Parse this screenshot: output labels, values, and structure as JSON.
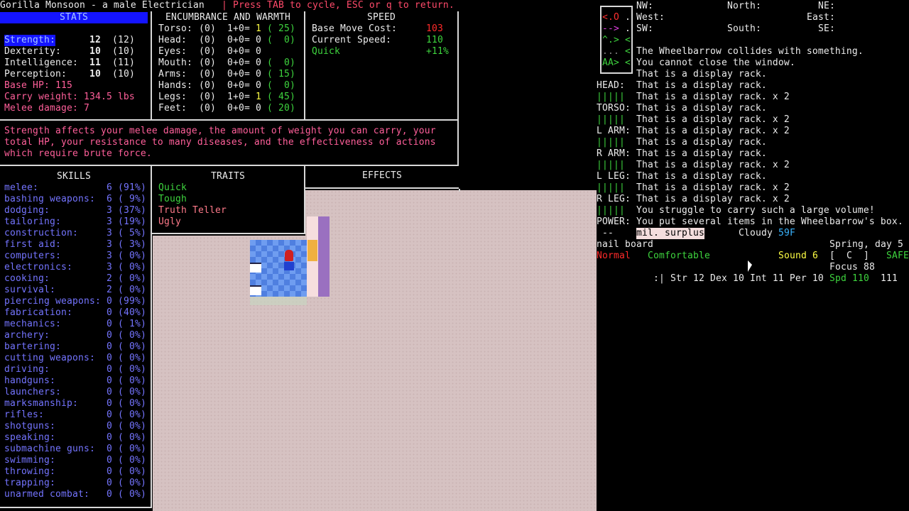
{
  "header": {
    "title": "Gorilla Monsoon - a male Electrician",
    "hint": "| Press TAB to cycle, ESC or q to return."
  },
  "stats": {
    "title": "STATS",
    "rows": [
      {
        "label": "Strength:",
        "value": "12",
        "base": "(12)",
        "selected": true
      },
      {
        "label": "Dexterity:",
        "value": "10",
        "base": "(10)"
      },
      {
        "label": "Intelligence:",
        "value": "11",
        "base": "(11)"
      },
      {
        "label": "Perception:",
        "value": "10",
        "base": "(10)"
      }
    ],
    "base_hp": "Base HP: 115",
    "carry_weight": "Carry weight: 134.5 lbs",
    "melee_damage": "Melee damage: 7"
  },
  "encumbrance": {
    "title": "ENCUMBRANCE AND WARMTH",
    "rows": [
      {
        "part": "Torso:",
        "layers": "(0)",
        "formula": "1+0=",
        "total": "1",
        "warmth": "( 25)",
        "highlight": true
      },
      {
        "part": "Head:",
        "layers": "(0)",
        "formula": "0+0=",
        "total": "0",
        "warmth": "(  0)"
      },
      {
        "part": "Eyes:",
        "layers": "(0)",
        "formula": "0+0=",
        "total": "0",
        "warmth": ""
      },
      {
        "part": "Mouth:",
        "layers": "(0)",
        "formula": "0+0=",
        "total": "0",
        "warmth": "(  0)"
      },
      {
        "part": "Arms:",
        "layers": "(0)",
        "formula": "0+0=",
        "total": "0",
        "warmth": "( 15)"
      },
      {
        "part": "Hands:",
        "layers": "(0)",
        "formula": "0+0=",
        "total": "0",
        "warmth": "(  0)"
      },
      {
        "part": "Legs:",
        "layers": "(0)",
        "formula": "1+0=",
        "total": "1",
        "warmth": "( 45)",
        "highlight": true
      },
      {
        "part": "Feet:",
        "layers": "(0)",
        "formula": "0+0=",
        "total": "0",
        "warmth": "( 20)"
      }
    ]
  },
  "speed": {
    "title": "SPEED",
    "base_move_cost_label": "Base Move Cost:",
    "base_move_cost": "103",
    "current_speed_label": "Current Speed:",
    "current_speed": "110",
    "modifier_label": "Quick",
    "modifier": "+11%"
  },
  "description": "Strength affects your melee damage, the amount of weight you can carry, your\ntotal HP, your resistance to many diseases, and the effectiveness of actions\nwhich require brute force.",
  "skills": {
    "title": "SKILLS",
    "rows": [
      [
        "melee:",
        "6 (91%)"
      ],
      [
        "bashing weapons:",
        "6 ( 9%)"
      ],
      [
        "dodging:",
        "3 (37%)"
      ],
      [
        "tailoring:",
        "3 (19%)"
      ],
      [
        "construction:",
        "3 ( 5%)"
      ],
      [
        "first aid:",
        "3 ( 3%)"
      ],
      [
        "computers:",
        "3 ( 0%)"
      ],
      [
        "electronics:",
        "3 ( 0%)"
      ],
      [
        "cooking:",
        "2 ( 0%)"
      ],
      [
        "survival:",
        "2 ( 0%)"
      ],
      [
        "piercing weapons:",
        "0 (99%)"
      ],
      [
        "fabrication:",
        "0 (40%)"
      ],
      [
        "mechanics:",
        "0 ( 1%)"
      ],
      [
        "archery:",
        "0 ( 0%)"
      ],
      [
        "bartering:",
        "0 ( 0%)"
      ],
      [
        "cutting weapons:",
        "0 ( 0%)"
      ],
      [
        "driving:",
        "0 ( 0%)"
      ],
      [
        "handguns:",
        "0 ( 0%)"
      ],
      [
        "launchers:",
        "0 ( 0%)"
      ],
      [
        "marksmanship:",
        "0 ( 0%)"
      ],
      [
        "rifles:",
        "0 ( 0%)"
      ],
      [
        "shotguns:",
        "0 ( 0%)"
      ],
      [
        "speaking:",
        "0 ( 0%)"
      ],
      [
        "submachine guns:",
        "0 ( 0%)"
      ],
      [
        "swimming:",
        "0 ( 0%)"
      ],
      [
        "throwing:",
        "0 ( 0%)"
      ],
      [
        "trapping:",
        "0 ( 0%)"
      ],
      [
        "unarmed combat:",
        "0 ( 0%)"
      ]
    ]
  },
  "traits": {
    "title": "TRAITS",
    "rows": [
      {
        "name": "Quick",
        "color": "#3ed43e"
      },
      {
        "name": "Tough",
        "color": "#3ed43e"
      },
      {
        "name": "Truth Teller",
        "color": "#ff7a8a"
      },
      {
        "name": "Ugly",
        "color": "#ff7a8a"
      }
    ]
  },
  "effects": {
    "title": "EFFECTS"
  },
  "directions": {
    "nw": "NW:",
    "north": "North:",
    "ne": "NE:",
    "west": "West:",
    "east": "East:",
    "sw": "SW:",
    "south": "South:",
    "se": "SE:"
  },
  "minimap": {
    "rows": [
      "<.O",
      "-->",
      "^.>",
      "...",
      "AA>"
    ],
    "side": [
      ".",
      ".",
      "<",
      "<",
      "<"
    ]
  },
  "body_status": [
    {
      "label": "HEAD:"
    },
    {
      "label": "|||||"
    },
    {
      "label": "TORSO:"
    },
    {
      "label": "|||||"
    },
    {
      "label": "L ARM:"
    },
    {
      "label": "|||||"
    },
    {
      "label": "R ARM:"
    },
    {
      "label": "|||||"
    },
    {
      "label": "L LEG:"
    },
    {
      "label": "|||||"
    },
    {
      "label": "R LEG:"
    },
    {
      "label": "|||||"
    },
    {
      "label": "POWER:"
    }
  ],
  "messages": [
    "The Wheelbarrow collides with something.",
    "You cannot close the window.",
    "That is a display rack.",
    "That is a display rack.",
    "That is a display rack. x 2",
    "That is a display rack.",
    "That is a display rack. x 2",
    "That is a display rack. x 2",
    "That is a display rack.",
    "That is a display rack.",
    "That is a display rack. x 2",
    "That is a display rack.",
    "That is a display rack. x 2",
    "That is a display rack. x 2",
    "You struggle to carry such a large volume!",
    "You put several items in the Wheelbarrow's box."
  ],
  "status": {
    "power": "--",
    "location": "mil. surplus",
    "weather": "Cloudy",
    "temperature": "59F",
    "wielded": "nail board",
    "date": "Spring, day 5",
    "hunger": "Normal",
    "warmth": "Comfortable",
    "sound": "Sound 6",
    "stance": "[  C  ]",
    "safe_mode": "SAFE",
    "focus": "Focus 88",
    "stats_line": ":| Str 12 Dex 10 Int 11 Per 10",
    "speed": "Spd 110",
    "moves": "111"
  },
  "colors": {
    "stats_title_bg": "#1414ff",
    "skill_text": "#7474ff",
    "pink_text": "#ff5f9a",
    "good": "#3ed43e",
    "bad": "#ff2a2a",
    "map_floor": "#d6c2c2"
  }
}
